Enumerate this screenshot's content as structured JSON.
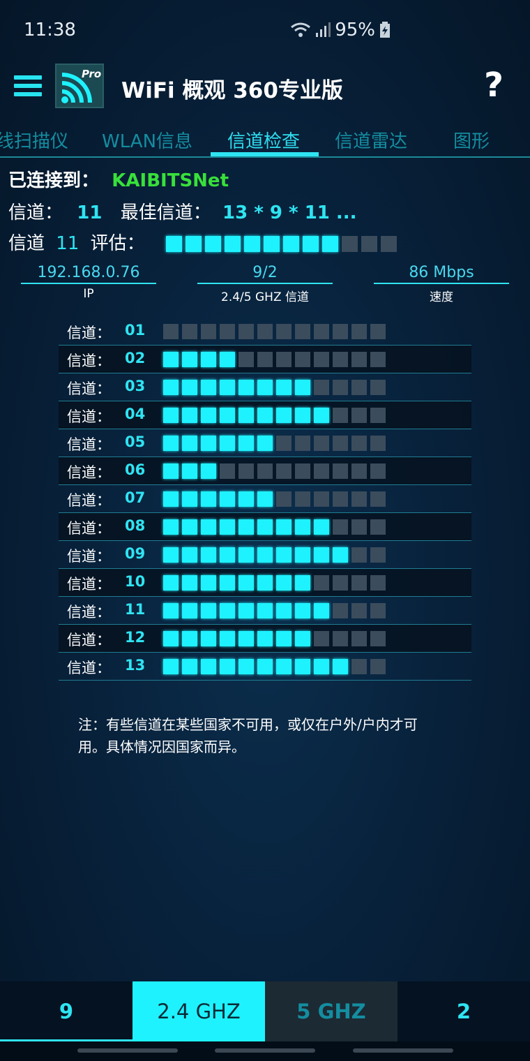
{
  "status": {
    "time": "11:38",
    "battery": "95%"
  },
  "app": {
    "title": "WiFi 概观 360专业版",
    "help": "?"
  },
  "tabs": [
    {
      "label": "线扫描仪"
    },
    {
      "label": "WLAN信息"
    },
    {
      "label": "信道检查",
      "active": true
    },
    {
      "label": "信道雷达"
    },
    {
      "label": "图形"
    }
  ],
  "connection": {
    "connected_label": "已连接到：",
    "ssid": "KAIBITSNet",
    "channel_label": "信道：",
    "channel": "11",
    "best_label": "最佳信道：",
    "best": "13 * 9 * 11 ...",
    "rating_prefix": "信道",
    "rating_channel": "11",
    "rating_suffix": "评估：",
    "rating_level": 9,
    "rating_max": 12
  },
  "stats": [
    {
      "value": "192.168.0.76",
      "label": "IP"
    },
    {
      "value": "9/2",
      "label": "2.4/5 GHZ 信道"
    },
    {
      "value": "86 Mbps",
      "label": "速度"
    }
  ],
  "channel_label": "信道：",
  "channels": [
    {
      "num": "01",
      "level": 0
    },
    {
      "num": "02",
      "level": 4
    },
    {
      "num": "03",
      "level": 8
    },
    {
      "num": "04",
      "level": 9
    },
    {
      "num": "05",
      "level": 6
    },
    {
      "num": "06",
      "level": 3
    },
    {
      "num": "07",
      "level": 6
    },
    {
      "num": "08",
      "level": 9
    },
    {
      "num": "09",
      "level": 10
    },
    {
      "num": "10",
      "level": 8
    },
    {
      "num": "11",
      "level": 9
    },
    {
      "num": "12",
      "level": 8
    },
    {
      "num": "13",
      "level": 10
    }
  ],
  "channel_bar_max": 12,
  "note": "注：有些信道在某些国家不可用，或仅在户外/户内才可用。具体情况因国家而异。",
  "bottom": [
    {
      "label": "9"
    },
    {
      "label": "2.4 GHZ"
    },
    {
      "label": "5 GHZ"
    },
    {
      "label": "2"
    }
  ],
  "colors": {
    "accent": "#2fe4f2",
    "ssid": "#38e03a",
    "bar_off": "#3b4c5c"
  }
}
